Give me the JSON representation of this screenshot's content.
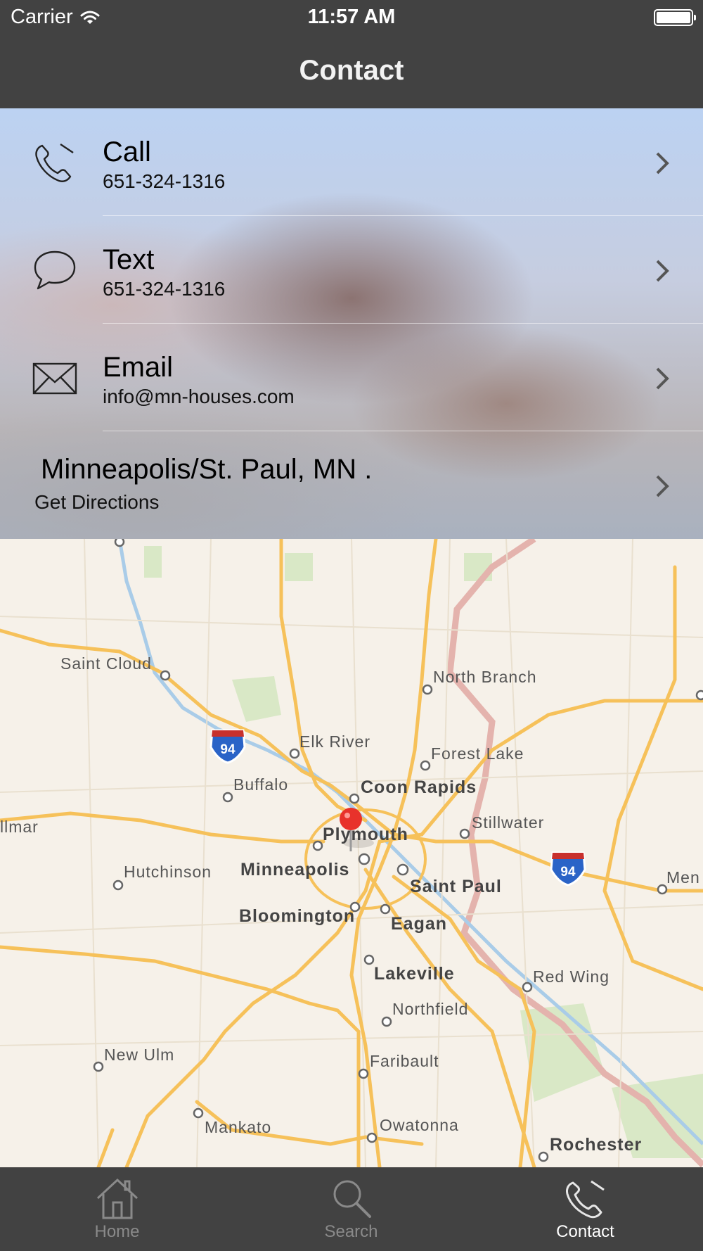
{
  "status_bar": {
    "carrier": "Carrier",
    "time": "11:57 AM",
    "battery_icon": "battery-icon",
    "wifi_icon": "wifi-icon"
  },
  "nav": {
    "title": "Contact"
  },
  "contact": {
    "items": [
      {
        "icon": "phone-icon",
        "title": "Call",
        "subtitle": "651-324-1316"
      },
      {
        "icon": "speech-bubble-icon",
        "title": "Text",
        "subtitle": "651-324-1316"
      },
      {
        "icon": "envelope-icon",
        "title": "Email",
        "subtitle": "info@mn-houses.com"
      }
    ],
    "location": {
      "title": "Minneapolis/St. Paul, MN .",
      "subtitle": "Get Directions"
    }
  },
  "map": {
    "labels": {
      "saint_cloud": "Saint Cloud",
      "north_branch": "North Branch",
      "elk_river": "Elk River",
      "forest_lake": "Forest Lake",
      "buffalo": "Buffalo",
      "coon_rapids": "Coon Rapids",
      "willmar": "llmar",
      "stillwater": "Stillwater",
      "plymouth": "Plymouth",
      "hutchinson": "Hutchinson",
      "minneapolis": "Minneapolis",
      "saint_paul": "Saint Paul",
      "menomonie": "Men",
      "bloomington": "Bloomington",
      "eagan": "Eagan",
      "lakeville": "Lakeville",
      "red_wing": "Red Wing",
      "northfield": "Northfield",
      "new_ulm": "New Ulm",
      "faribault": "Faribault",
      "mankato": "Mankato",
      "owatonna": "Owatonna",
      "rochester": "Rochester"
    },
    "shields": [
      "94",
      "94"
    ],
    "pin_icon": "map-pin-icon"
  },
  "tabs": [
    {
      "icon": "home-icon",
      "label": "Home",
      "active": false
    },
    {
      "icon": "search-icon",
      "label": "Search",
      "active": false
    },
    {
      "icon": "phone-icon",
      "label": "Contact",
      "active": true
    }
  ],
  "colors": {
    "bar": "#424242",
    "tab_inactive": "#8a8a8a",
    "tab_active": "#ffffff",
    "pin": "#e8322b",
    "road": "#f6c15a",
    "interstate_shield": "#2a63c7"
  }
}
